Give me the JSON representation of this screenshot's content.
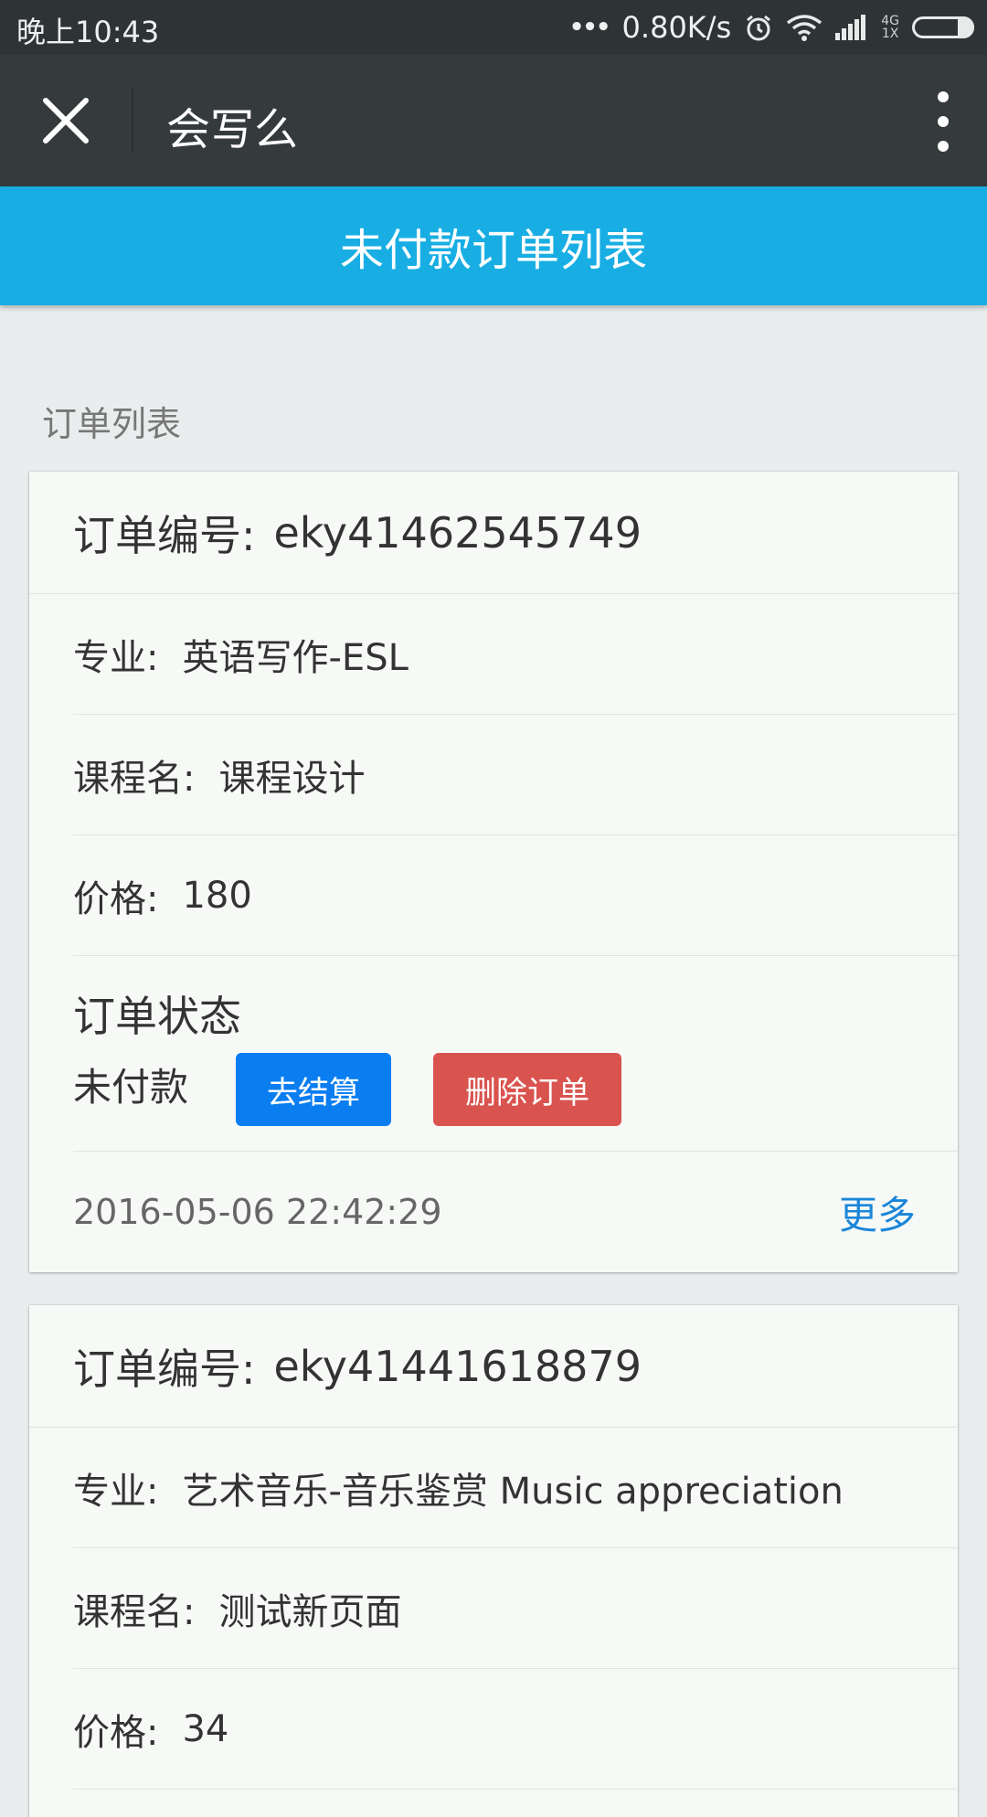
{
  "status_bar": {
    "time": "晚上10:43",
    "dots": "•••",
    "speed": "0.80K/s",
    "net_top": "4G",
    "net_bottom": "1X",
    "icons": [
      "alarm-icon",
      "wifi-icon",
      "signal-icon",
      "battery-icon"
    ]
  },
  "app_bar": {
    "title": "会写么",
    "close_icon": "close-icon",
    "menu_icon": "more-vertical-icon"
  },
  "page": {
    "header_title": "未付款订单列表",
    "section_label": "订单列表"
  },
  "orders": [
    {
      "order_no_label": "订单编号:",
      "order_no": "eky41462545749",
      "major_label": "专业:",
      "major": "英语写作-ESL",
      "course_label": "课程名:",
      "course": "课程设计",
      "price_label": "价格:",
      "price": "180",
      "status_title": "订单状态",
      "status": "未付款",
      "pay_button": "去结算",
      "delete_button": "删除订单",
      "time": "2016-05-06 22:42:29",
      "more": "更多"
    },
    {
      "order_no_label": "订单编号:",
      "order_no": "eky41441618879",
      "major_label": "专业:",
      "major": "艺术音乐-音乐鉴赏 Music appreciation",
      "course_label": "课程名:",
      "course": "测试新页面",
      "price_label": "价格:",
      "price": "34"
    }
  ],
  "colors": {
    "status_bar": "#2e3336",
    "app_bar": "#353a3d",
    "header": "#18aee3",
    "pay_button": "#0a7ef0",
    "delete_button": "#d9534f",
    "link": "#1b86d9"
  }
}
